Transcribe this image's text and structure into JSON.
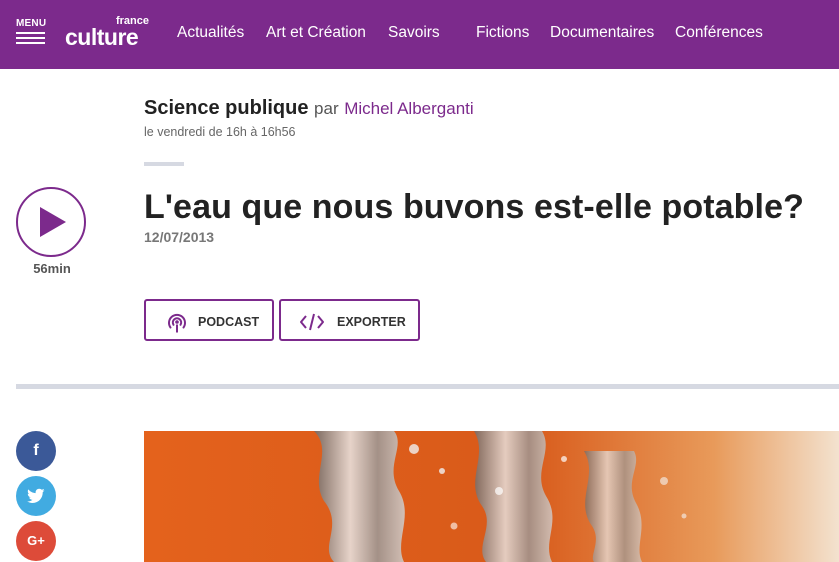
{
  "header": {
    "menu_label": "MENU",
    "logo_top": "france",
    "logo_main": "culture",
    "nav": [
      "Actualités",
      "Art et Création",
      "Savoirs",
      "Fictions",
      "Documentaires",
      "Conférences"
    ]
  },
  "show": {
    "name": "Science publique",
    "by": "par",
    "author": "Michel Alberganti",
    "schedule": "le vendredi de 16h à 16h56"
  },
  "episode": {
    "title": "L'eau que nous buvons est-elle potable?",
    "date": "12/07/2013",
    "duration": "56min"
  },
  "actions": {
    "podcast": "PODCAST",
    "export": "EXPORTER"
  },
  "social": {
    "facebook_glyph": "f",
    "googleplus_glyph": "G+"
  },
  "colors": {
    "brand": "#7c2a8c",
    "facebook": "#3b5998",
    "twitter": "#41abe1",
    "googleplus": "#dd4b39",
    "divider": "#d6d9e2"
  }
}
